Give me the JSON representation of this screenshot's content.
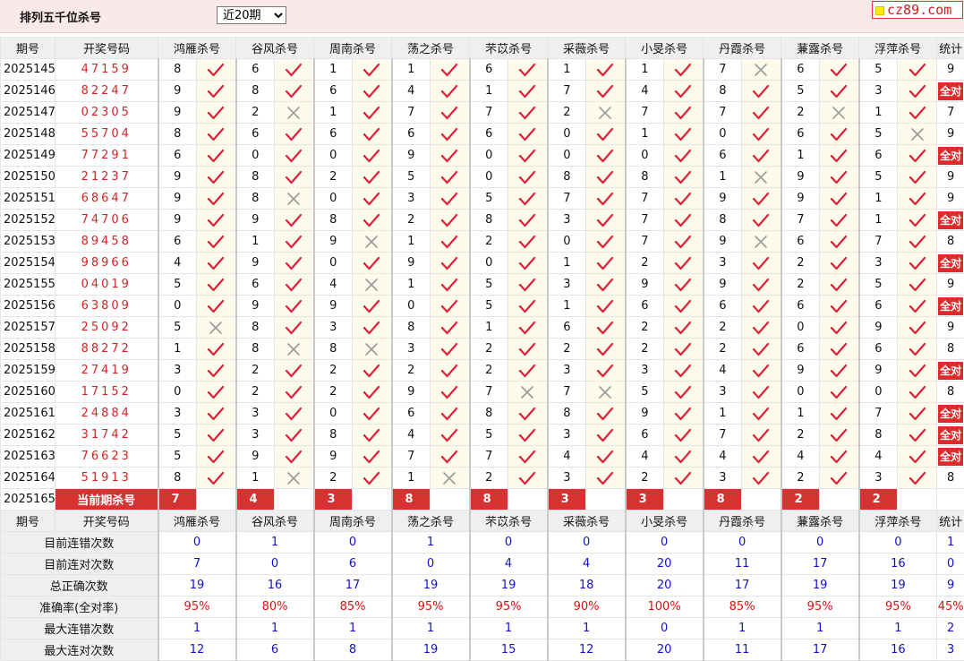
{
  "header": {
    "title": "排列五千位杀号",
    "range_select": "近20期",
    "logo": "cz89.com"
  },
  "columns": {
    "period": "期号",
    "draw": "开奖号码",
    "experts": [
      "鸿雁杀号",
      "谷风杀号",
      "周南杀号",
      "荡之杀号",
      "芣苡杀号",
      "采薇杀号",
      "小旻杀号",
      "丹霞杀号",
      "蒹露杀号",
      "浮萍杀号"
    ],
    "stat": "统计"
  },
  "rows": [
    {
      "period": "2025145",
      "draw": "47159",
      "kills": [
        8,
        6,
        1,
        1,
        6,
        1,
        1,
        7,
        6,
        5
      ],
      "ok": [
        1,
        1,
        1,
        1,
        1,
        1,
        1,
        0,
        1,
        1
      ],
      "stat": "9"
    },
    {
      "period": "2025146",
      "draw": "82247",
      "kills": [
        9,
        8,
        6,
        4,
        1,
        7,
        4,
        8,
        5,
        3
      ],
      "ok": [
        1,
        1,
        1,
        1,
        1,
        1,
        1,
        1,
        1,
        1
      ],
      "stat": "全对"
    },
    {
      "period": "2025147",
      "draw": "02305",
      "kills": [
        9,
        2,
        1,
        7,
        7,
        2,
        7,
        7,
        2,
        1
      ],
      "ok": [
        1,
        0,
        1,
        1,
        1,
        0,
        1,
        1,
        0,
        1
      ],
      "stat": "7"
    },
    {
      "period": "2025148",
      "draw": "55704",
      "kills": [
        8,
        6,
        6,
        6,
        6,
        0,
        1,
        0,
        6,
        5
      ],
      "ok": [
        1,
        1,
        1,
        1,
        1,
        1,
        1,
        1,
        1,
        0
      ],
      "stat": "9"
    },
    {
      "period": "2025149",
      "draw": "77291",
      "kills": [
        6,
        0,
        0,
        9,
        0,
        0,
        0,
        6,
        1,
        6
      ],
      "ok": [
        1,
        1,
        1,
        1,
        1,
        1,
        1,
        1,
        1,
        1
      ],
      "stat": "全对"
    },
    {
      "period": "2025150",
      "draw": "21237",
      "kills": [
        9,
        8,
        2,
        5,
        0,
        8,
        8,
        1,
        9,
        5
      ],
      "ok": [
        1,
        1,
        1,
        1,
        1,
        1,
        1,
        0,
        1,
        1
      ],
      "stat": "9"
    },
    {
      "period": "2025151",
      "draw": "68647",
      "kills": [
        9,
        8,
        0,
        3,
        5,
        7,
        7,
        9,
        9,
        1
      ],
      "ok": [
        1,
        0,
        1,
        1,
        1,
        1,
        1,
        1,
        1,
        1
      ],
      "stat": "9"
    },
    {
      "period": "2025152",
      "draw": "74706",
      "kills": [
        9,
        9,
        8,
        2,
        8,
        3,
        7,
        8,
        7,
        1
      ],
      "ok": [
        1,
        1,
        1,
        1,
        1,
        1,
        1,
        1,
        1,
        1
      ],
      "stat": "全对"
    },
    {
      "period": "2025153",
      "draw": "89458",
      "kills": [
        6,
        1,
        9,
        1,
        2,
        0,
        7,
        9,
        6,
        7
      ],
      "ok": [
        1,
        1,
        0,
        1,
        1,
        1,
        1,
        0,
        1,
        1
      ],
      "stat": "8"
    },
    {
      "period": "2025154",
      "draw": "98966",
      "kills": [
        4,
        9,
        0,
        9,
        0,
        1,
        2,
        3,
        2,
        3
      ],
      "ok": [
        1,
        1,
        1,
        1,
        1,
        1,
        1,
        1,
        1,
        1
      ],
      "stat": "全对"
    },
    {
      "period": "2025155",
      "draw": "04019",
      "kills": [
        5,
        6,
        4,
        1,
        5,
        3,
        9,
        9,
        2,
        5
      ],
      "ok": [
        1,
        1,
        0,
        1,
        1,
        1,
        1,
        1,
        1,
        1
      ],
      "stat": "9"
    },
    {
      "period": "2025156",
      "draw": "63809",
      "kills": [
        0,
        9,
        9,
        0,
        5,
        1,
        6,
        6,
        6,
        6
      ],
      "ok": [
        1,
        1,
        1,
        1,
        1,
        1,
        1,
        1,
        1,
        1
      ],
      "stat": "全对"
    },
    {
      "period": "2025157",
      "draw": "25092",
      "kills": [
        5,
        8,
        3,
        8,
        1,
        6,
        2,
        2,
        0,
        9
      ],
      "ok": [
        0,
        1,
        1,
        1,
        1,
        1,
        1,
        1,
        1,
        1
      ],
      "stat": "9"
    },
    {
      "period": "2025158",
      "draw": "88272",
      "kills": [
        1,
        8,
        8,
        3,
        2,
        2,
        2,
        2,
        6,
        6
      ],
      "ok": [
        1,
        0,
        0,
        1,
        1,
        1,
        1,
        1,
        1,
        1
      ],
      "stat": "8"
    },
    {
      "period": "2025159",
      "draw": "27419",
      "kills": [
        3,
        2,
        2,
        2,
        2,
        3,
        3,
        4,
        9,
        9
      ],
      "ok": [
        1,
        1,
        1,
        1,
        1,
        1,
        1,
        1,
        1,
        1
      ],
      "stat": "全对"
    },
    {
      "period": "2025160",
      "draw": "17152",
      "kills": [
        0,
        2,
        2,
        9,
        7,
        7,
        5,
        3,
        0,
        0
      ],
      "ok": [
        1,
        1,
        1,
        1,
        0,
        0,
        1,
        1,
        1,
        1
      ],
      "stat": "8"
    },
    {
      "period": "2025161",
      "draw": "24884",
      "kills": [
        3,
        3,
        0,
        6,
        8,
        8,
        9,
        1,
        1,
        7
      ],
      "ok": [
        1,
        1,
        1,
        1,
        1,
        1,
        1,
        1,
        1,
        1
      ],
      "stat": "全对"
    },
    {
      "period": "2025162",
      "draw": "31742",
      "kills": [
        5,
        3,
        8,
        4,
        5,
        3,
        6,
        7,
        2,
        8
      ],
      "ok": [
        1,
        1,
        1,
        1,
        1,
        1,
        1,
        1,
        1,
        1
      ],
      "stat": "全对"
    },
    {
      "period": "2025163",
      "draw": "76623",
      "kills": [
        5,
        9,
        9,
        7,
        7,
        4,
        4,
        4,
        4,
        4
      ],
      "ok": [
        1,
        1,
        1,
        1,
        1,
        1,
        1,
        1,
        1,
        1
      ],
      "stat": "全对"
    },
    {
      "period": "2025164",
      "draw": "51913",
      "kills": [
        8,
        1,
        2,
        1,
        2,
        3,
        2,
        3,
        2,
        3
      ],
      "ok": [
        1,
        0,
        1,
        0,
        1,
        1,
        1,
        1,
        1,
        1
      ],
      "stat": "8"
    }
  ],
  "current": {
    "period": "2025165",
    "label": "当前期杀号",
    "kills": [
      "7",
      "4",
      "3",
      "8",
      "8",
      "3",
      "3",
      "8",
      "2",
      "2"
    ]
  },
  "summary": [
    {
      "label": "目前连错次数",
      "values": [
        "0",
        "1",
        "0",
        "1",
        "0",
        "0",
        "0",
        "0",
        "0",
        "0"
      ],
      "stat": "1",
      "color": "blue"
    },
    {
      "label": "目前连对次数",
      "values": [
        "7",
        "0",
        "6",
        "0",
        "4",
        "4",
        "20",
        "11",
        "17",
        "16"
      ],
      "stat": "0",
      "color": "blue"
    },
    {
      "label": "总正确次数",
      "values": [
        "19",
        "16",
        "17",
        "19",
        "19",
        "18",
        "20",
        "17",
        "19",
        "19"
      ],
      "stat": "9",
      "color": "blue"
    },
    {
      "label": "准确率(全对率)",
      "values": [
        "95%",
        "80%",
        "85%",
        "95%",
        "95%",
        "90%",
        "100%",
        "85%",
        "95%",
        "95%"
      ],
      "stat": "45%",
      "color": "red"
    },
    {
      "label": "最大连错次数",
      "values": [
        "1",
        "1",
        "1",
        "1",
        "1",
        "1",
        "0",
        "1",
        "1",
        "1"
      ],
      "stat": "2",
      "color": "blue"
    },
    {
      "label": "最大连对次数",
      "values": [
        "12",
        "6",
        "8",
        "19",
        "15",
        "12",
        "20",
        "11",
        "17",
        "16"
      ],
      "stat": "3",
      "color": "blue"
    }
  ],
  "colors": {
    "accent_red": "#d72d2d",
    "check_red": "#e0203a",
    "cross_gray": "#9a9a9a",
    "summary_blue": "#1111cc",
    "header_bg": "#efefef",
    "topbar_bg": "#fbe9e9"
  },
  "icons": {
    "ok": "check-icon",
    "miss": "cross-icon",
    "logo_square": "yellow-square-icon"
  }
}
